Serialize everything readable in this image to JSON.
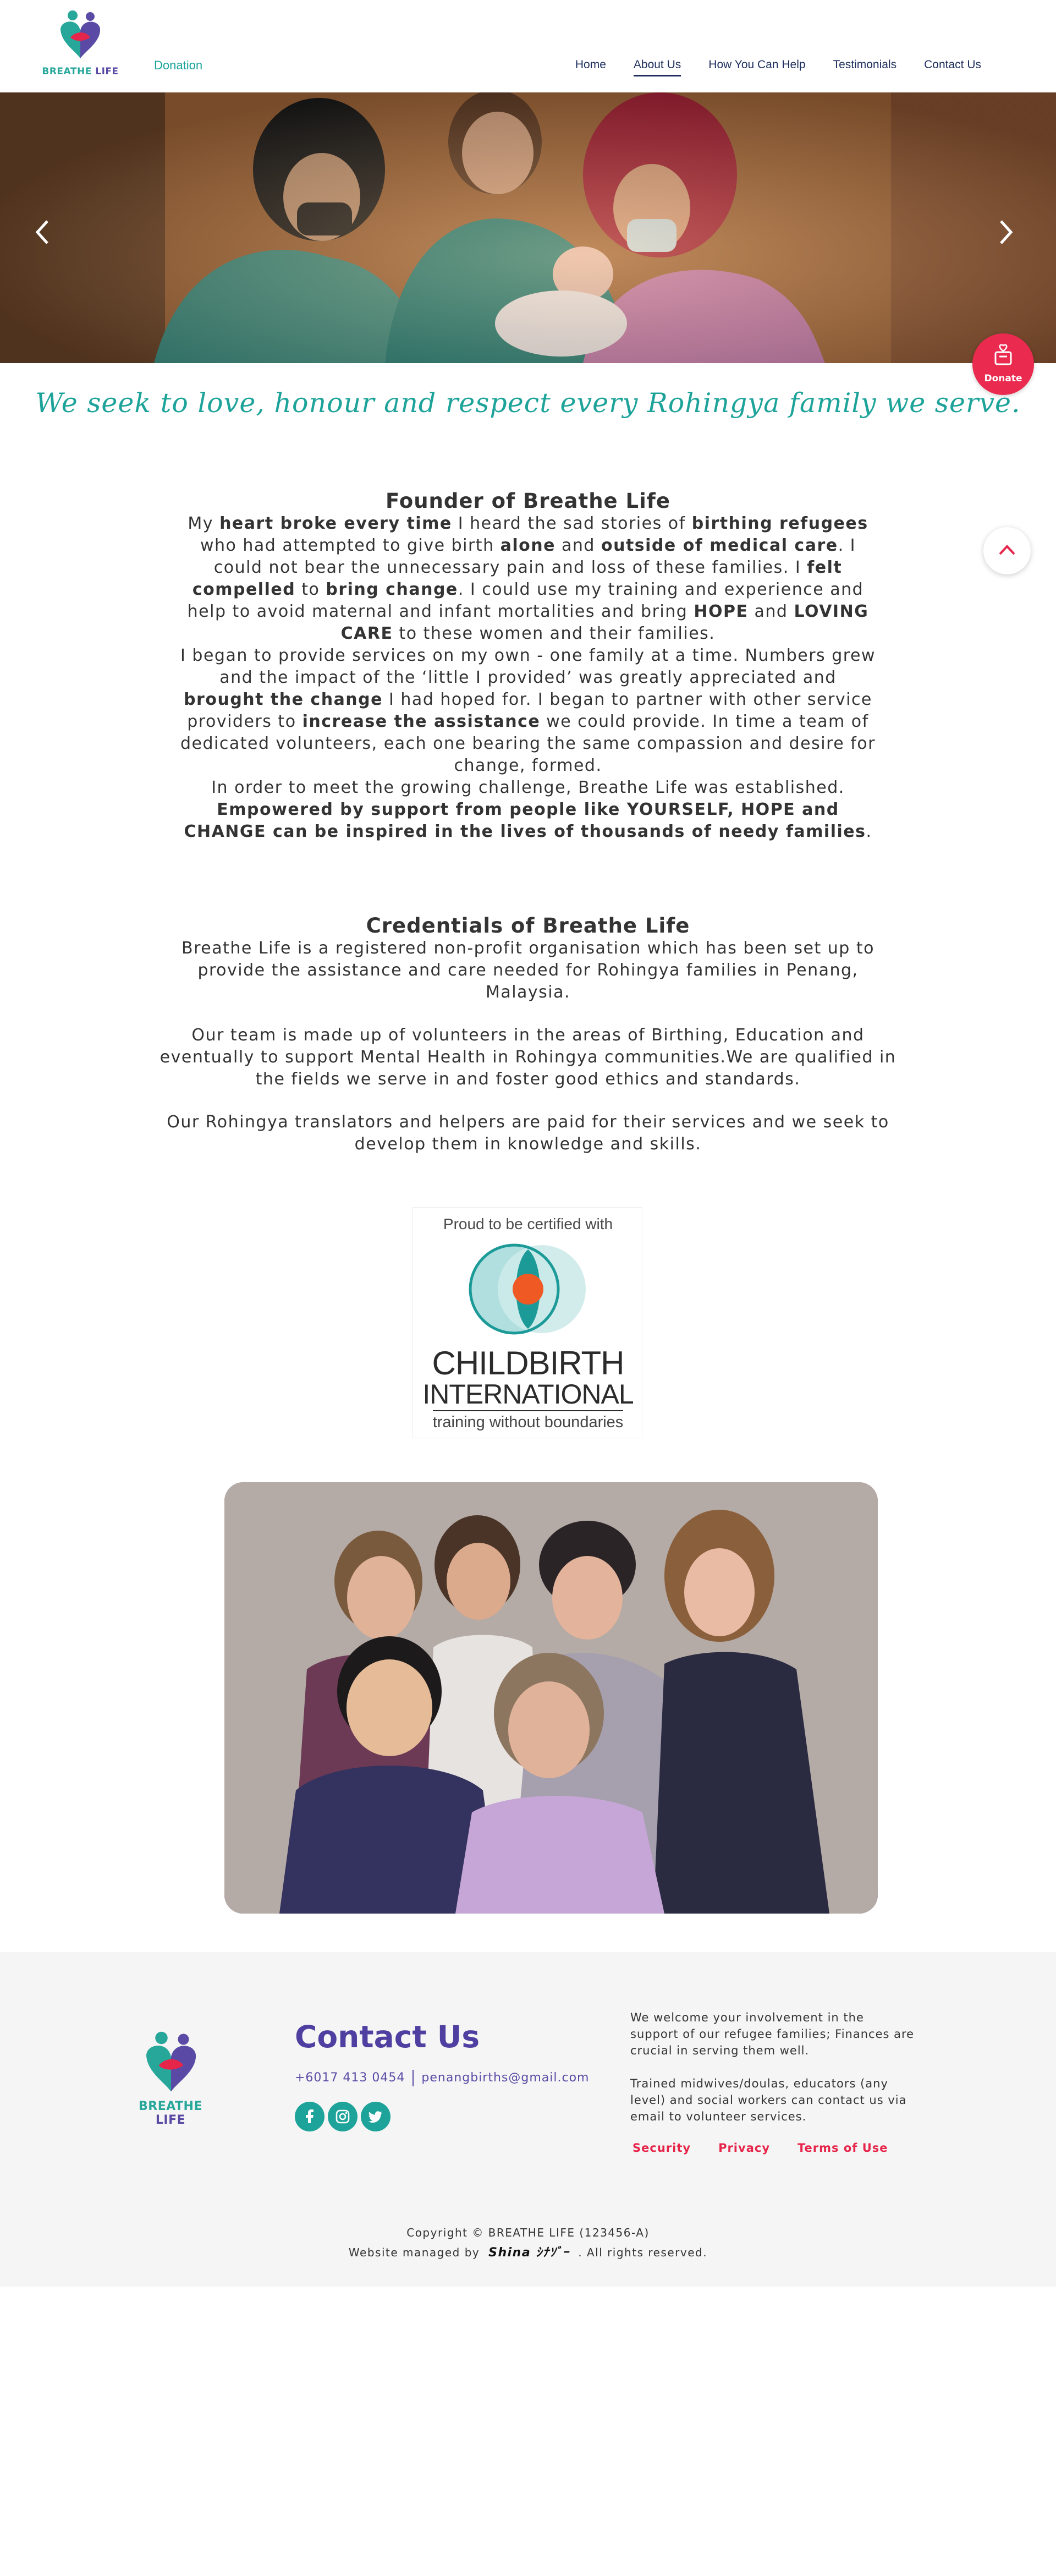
{
  "brand": {
    "name_part1": "BREATHE",
    "name_part2": "LIFE"
  },
  "nav": {
    "donation": "Donation",
    "items": [
      {
        "label": "Home",
        "active": false
      },
      {
        "label": "About Us",
        "active": true
      },
      {
        "label": "How You Can Help",
        "active": false
      },
      {
        "label": "Testimonials",
        "active": false
      },
      {
        "label": "Contact Us",
        "active": false
      }
    ]
  },
  "hero": {
    "prev_icon": "chevron-left-icon",
    "next_icon": "chevron-right-icon"
  },
  "donate_button": {
    "label": "Donate",
    "icon": "donation-box-icon",
    "color": "#ea2a4e"
  },
  "scroll_top": {
    "icon": "chevron-up-icon"
  },
  "tagline": "We seek to love, honour and respect every Rohingya family we serve.",
  "founder": {
    "title": "Founder of Breathe Life",
    "p1": {
      "a": "My ",
      "b1": "heart broke every time",
      "c": " I heard the sad stories of ",
      "b2": "birthing refugees",
      "d": " who had attempted to give birth ",
      "b3": "alone",
      "e": " and ",
      "b4": "outside of medical care",
      "f": ". I could not bear the unnecessary pain and loss of these families. I ",
      "b5": "felt compelled",
      "g": " to ",
      "b6": "bring change",
      "h": ". I could use my training and experience and help to avoid maternal and infant mortalities and bring ",
      "b7": "HOPE",
      "i": " and ",
      "b8": "LOVING CARE",
      "j": " to these women and their families."
    },
    "p2": {
      "a": "I began to provide services on my own - one family at a time. Numbers grew and the impact of the ‘little I provided’ was greatly appreciated and ",
      "b1": "brought the change",
      "c": " I had hoped for. I began to partner with other service providers to ",
      "b2": "increase the assistance",
      "d": " we could provide. In time a team of dedicated volunteers, each one bearing the same compassion and desire for change, formed."
    },
    "p3": {
      "a": "In order to meet the growing challenge, Breathe Life was established. ",
      "b1": "Empowered by support from people like YOURSELF, HOPE and CHANGE can be inspired in the lives of thousands of needy families",
      "c": "."
    }
  },
  "credentials": {
    "title": "Credentials of Breathe Life",
    "paragraphs": [
      "Breathe Life is a registered non-profit organisation which has been set up to provide the assistance and care needed for Rohingya families in Penang, Malaysia.",
      "Our team is made up of volunteers in the areas of Birthing, Education and eventually to support Mental Health in Rohingya communities.We are qualified in the fields we serve in and foster good ethics and standards.",
      "Our Rohingya translators and helpers are paid for their services and we seek to develop them in knowledge and skills."
    ]
  },
  "cert": {
    "proud": "Proud to be certified with",
    "line1": "CHILDBIRTH",
    "line2": "INTERNATIONAL",
    "line3": "training without boundaries"
  },
  "footer": {
    "contact_title": "Contact Us",
    "phone": "+6017 413 0454",
    "email": "penangbirths@gmail.com",
    "socials": [
      "facebook-icon",
      "instagram-icon",
      "twitter-icon"
    ],
    "text1": "We welcome your involvement in the support of our refugee families; Finances are crucial in serving them well.",
    "text2": "Trained midwives/doulas, educators (any level) and social workers can contact us via email to volunteer services.",
    "links": [
      "Security",
      "Privacy",
      "Terms of Use"
    ],
    "copyright": "Copyright © BREATHE LIFE (123456-A)",
    "managed_prefix": "Website managed by",
    "managed_brand": "Shina ｼﾅｿﾞｰ",
    "managed_suffix": ". All rights reserved."
  },
  "colors": {
    "teal": "#1ea39a",
    "purple": "#4f3fa0",
    "red": "#ea2a4e",
    "navy": "#1d2e5e",
    "footer_bg": "#f5f5f5"
  }
}
